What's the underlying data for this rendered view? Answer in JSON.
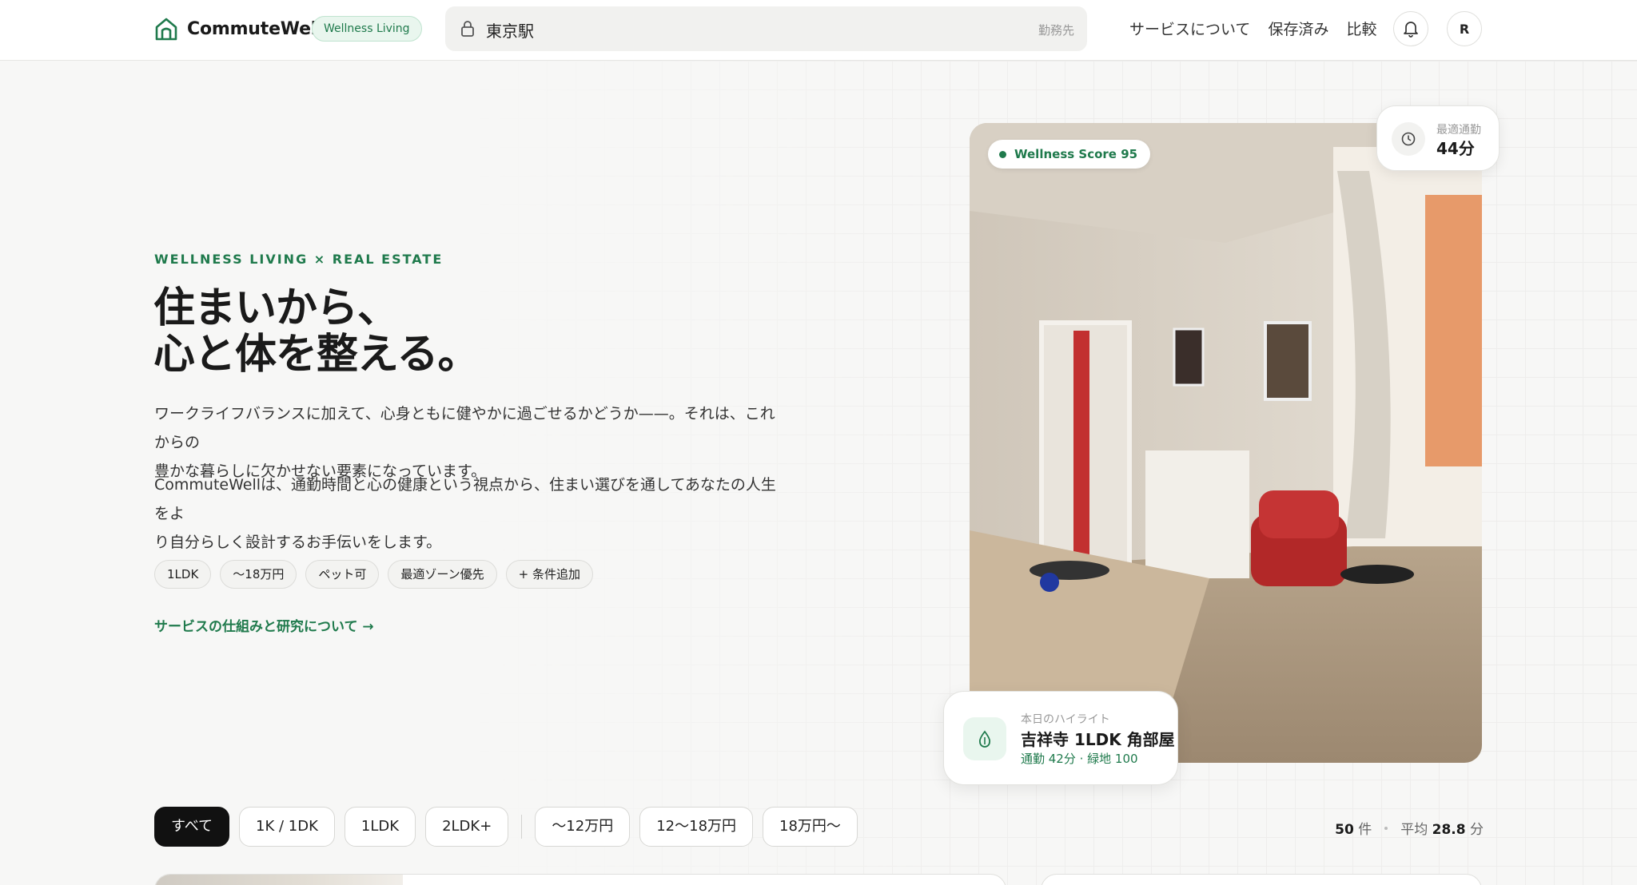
{
  "header": {
    "logo_text": "CommuteWell",
    "badge": "Wellness Living",
    "search_value": "東京駅",
    "search_hint": "勤務先",
    "nav": [
      "サービスについて",
      "保存済み",
      "比較"
    ],
    "avatar_initial": "R"
  },
  "hero": {
    "eyebrow": "WELLNESS LIVING × REAL ESTATE",
    "headline_line1": "住まいから、",
    "headline_line2": "心と体を整える。",
    "para1_line1": "ワークライフバランスに加えて、心身ともに健やかに過ごせるかどうか——。それは、これからの",
    "para1_line2": "豊かな暮らしに欠かせない要素になっています。",
    "para2_line1": "CommuteWellは、通勤時間と心の健康という視点から、住まい選びを通してあなたの人生をよ",
    "para2_line2": "り自分らしく設計するお手伝いをします。",
    "chips": [
      "1LDK",
      "〜18万円",
      "ペット可",
      "最適ゾーン優先",
      "+ 条件追加"
    ],
    "learn_link": "サービスの仕組みと研究について →"
  },
  "feature": {
    "score_label": "Wellness Score 95",
    "commute_label": "最適通勤",
    "commute_value": "44分",
    "highlight_label": "本日のハイライト",
    "highlight_title": "吉祥寺 1LDK 角部屋",
    "highlight_sub": "通勤 42分 · 緑地 100"
  },
  "filters": {
    "layout": [
      "すべて",
      "1K / 1DK",
      "1LDK",
      "2LDK+"
    ],
    "price": [
      "〜12万円",
      "12〜18万円",
      "18万円〜"
    ]
  },
  "stats": {
    "count": "50",
    "count_unit": "件",
    "avg_label": "平均",
    "avg_value": "28.8",
    "avg_unit": "分"
  },
  "colors": {
    "accent": "#1f7a4c",
    "accent_soft": "#e9f6ee",
    "active_filter": "#111111"
  },
  "icons": {
    "logo": "house-icon",
    "search": "lock-icon",
    "bell": "bell-icon",
    "commute": "clock-icon",
    "highlight": "leaf-drop-icon"
  }
}
